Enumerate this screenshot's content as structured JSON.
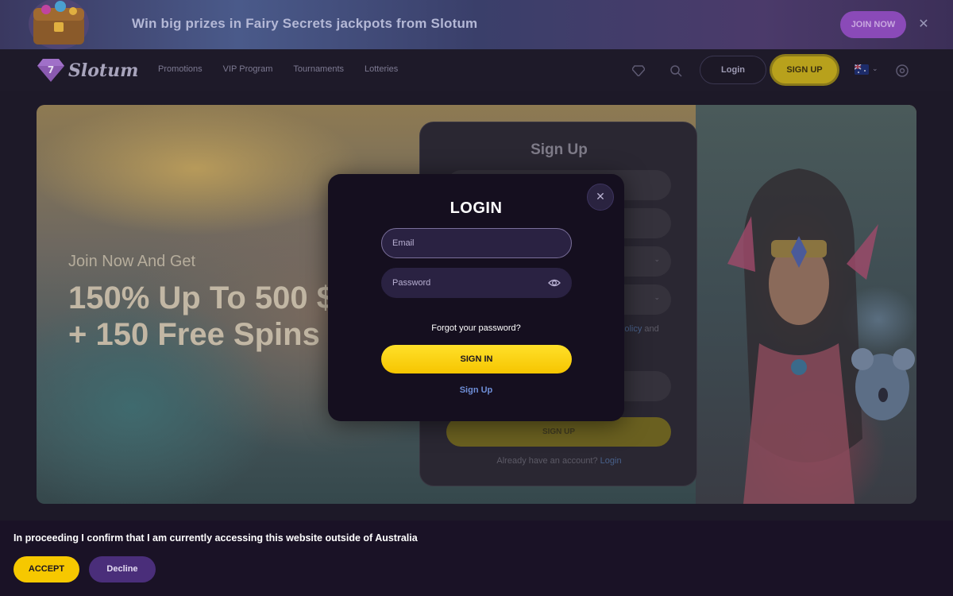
{
  "promo_banner": {
    "text": "Win big prizes in Fairy Secrets jackpots from Slotum",
    "join_label": "JOIN NOW",
    "close_icon": "close-icon"
  },
  "header": {
    "logo_text": "Slotum",
    "nav": [
      "Promotions",
      "VIP Program",
      "Tournaments",
      "Lotteries"
    ],
    "login_label": "Login",
    "signup_label": "SIGN UP",
    "icons": [
      "diamond-icon",
      "search-icon",
      "flag-australia-icon",
      "chat-icon"
    ]
  },
  "hero": {
    "subtitle": "Join Now And Get",
    "title_line1": "150% Up To 500 $",
    "title_line2": "+ 150 Free Spins"
  },
  "signup_card": {
    "title": "Sign Up",
    "policy_text": "Policy",
    "policy_and": "and",
    "submit_label": "SIGN UP",
    "already_text": "Already have an account?",
    "login_link": "Login"
  },
  "login_modal": {
    "title": "LOGIN",
    "email_placeholder": "Email",
    "password_placeholder": "Password",
    "forgot_label": "Forgot your password?",
    "signin_label": "SIGN IN",
    "signup_link": "Sign Up"
  },
  "region_notice": {
    "text": "In proceeding I confirm that I am currently accessing this website outside of Australia",
    "accept_label": "ACCEPT",
    "decline_label": "Decline"
  },
  "colors": {
    "accent_yellow": "#f6c800",
    "modal_bg": "#150f1f",
    "decline_purple": "#4a2e7a",
    "link_blue": "#6f8fd8"
  }
}
